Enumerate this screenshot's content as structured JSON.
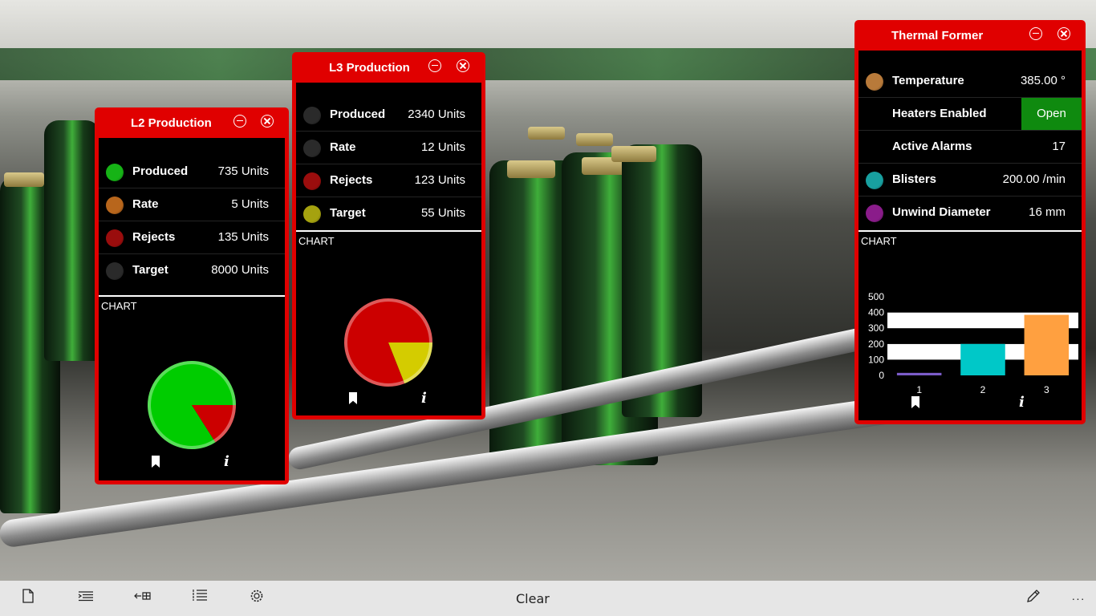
{
  "panels": {
    "l2": {
      "title": "L2 Production",
      "rows": [
        {
          "label": "Produced",
          "value": "735 Units",
          "color": "#16b316"
        },
        {
          "label": "Rate",
          "value": "5 Units",
          "color": "#b8661c"
        },
        {
          "label": "Rejects",
          "value": "135 Units",
          "color": "#9a0d0d"
        },
        {
          "label": "Target",
          "value": "8000 Units",
          "color": "#2a2a2a"
        }
      ],
      "chart_label": "CHART"
    },
    "l3": {
      "title": "L3 Production",
      "rows": [
        {
          "label": "Produced",
          "value": "2340 Units",
          "color": "#2a2a2a"
        },
        {
          "label": "Rate",
          "value": "12 Units",
          "color": "#2a2a2a"
        },
        {
          "label": "Rejects",
          "value": "123 Units",
          "color": "#9a0d0d"
        },
        {
          "label": "Target",
          "value": "55 Units",
          "color": "#a5a20f"
        }
      ],
      "chart_label": "CHART"
    },
    "thermal": {
      "title": "Thermal Former",
      "rows": [
        {
          "label": "Temperature",
          "value": "385.00 °",
          "color": "#b87a3a"
        },
        {
          "label": "Heaters Enabled",
          "value": "Open",
          "color": ""
        },
        {
          "label": "Active Alarms",
          "value": "17",
          "color": ""
        },
        {
          "label": "Blisters",
          "value": "200.00 /min",
          "color": "#18a0a0"
        },
        {
          "label": "Unwind Diameter",
          "value": "16 mm",
          "color": "#8a1c8a"
        }
      ],
      "chart_label": "CHART"
    }
  },
  "chart_data": [
    {
      "type": "pie",
      "slices": [
        {
          "value": 84,
          "color": "#00cc00"
        },
        {
          "value": 16,
          "color": "#cc0000"
        }
      ]
    },
    {
      "type": "pie",
      "slices": [
        {
          "value": 81,
          "color": "#cc0000"
        },
        {
          "value": 19,
          "color": "#d4cc00"
        }
      ]
    },
    {
      "type": "bar",
      "categories": [
        "1",
        "2",
        "3"
      ],
      "values": [
        16,
        200,
        385
      ],
      "colors": [
        "#7b5cc9",
        "#00c8c8",
        "#ffa040"
      ],
      "ylim": [
        0,
        500
      ],
      "yticks": [
        "0",
        "100",
        "200",
        "300",
        "400",
        "500"
      ],
      "grid": true
    }
  ],
  "appbar": {
    "clear_label": "Clear",
    "icons": [
      "new-page-icon",
      "indent-list-icon",
      "back-panel-icon",
      "numbered-list-icon",
      "settings-icon",
      "edit-icon",
      "more-icon"
    ]
  }
}
